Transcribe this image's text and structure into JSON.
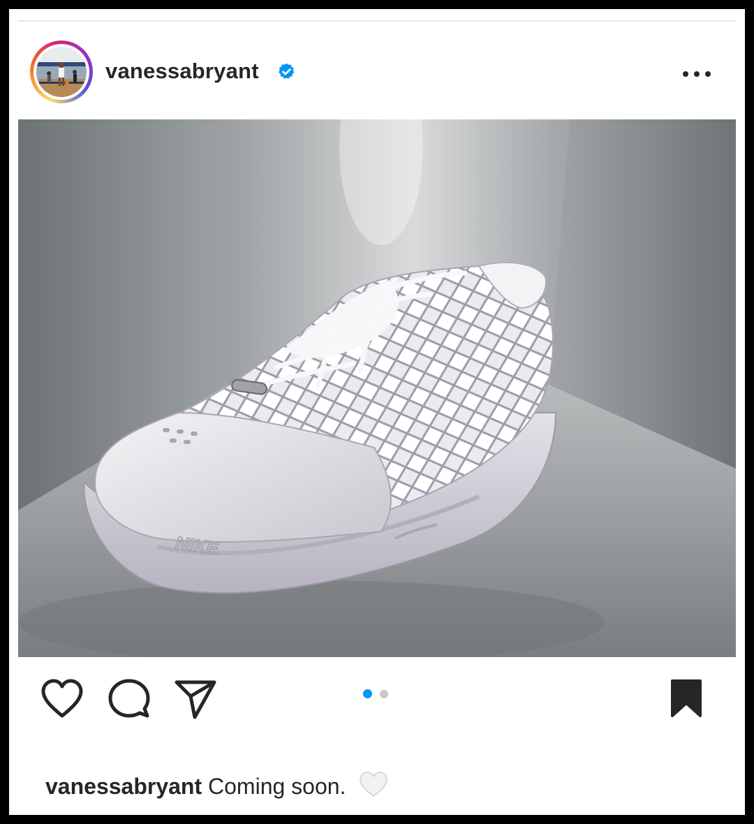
{
  "post": {
    "username": "vanessabryant",
    "verified": true,
    "more_icon": "more-horizontal-icon",
    "image": {
      "subject": "white Nike low-top basketball sneaker with lattice upper",
      "brand_mark": "NIKE"
    },
    "carousel": {
      "current": 1,
      "total": 2
    },
    "actions": {
      "like_icon": "heart-outline-icon",
      "comment_icon": "comment-icon",
      "share_icon": "paper-plane-icon",
      "save_icon": "bookmark-filled-icon"
    },
    "caption": {
      "username": "vanessabryant",
      "text": "Coming soon.",
      "emoji": "white-heart-emoji"
    }
  },
  "colors": {
    "text": "#262626",
    "verified": "#0095f6",
    "active_dot": "#0095f6",
    "inactive_dot": "#c7c7c7"
  }
}
